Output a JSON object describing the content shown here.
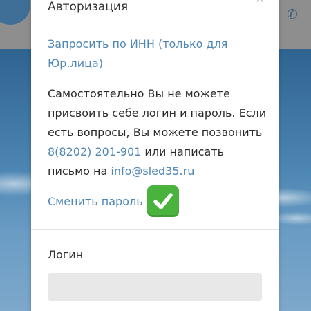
{
  "background": {
    "phone_icon": "phone-icon",
    "colors": {
      "topbar": "#8e8e8e",
      "sky": "#3f6f97"
    }
  },
  "modal": {
    "title": "Авторизация",
    "close_icon": "close-icon",
    "inn_link": "Запросить по ИНН (только для Юр.лица)",
    "info": {
      "line1": "Самостоятельно Вы не можете присвоить себе логин и пароль. Если есть вопросы, Вы можете позвонить ",
      "phone": "8(8202) 201-901",
      "middle": " или написать письмо на ",
      "email": "info@sled35.ru"
    },
    "change_password": "Сменить пароль",
    "check_icon": "check-mark-icon",
    "login_label": "Логин",
    "login_value": "",
    "colors": {
      "link": "#4f87b6",
      "check": "#49b33d"
    }
  }
}
